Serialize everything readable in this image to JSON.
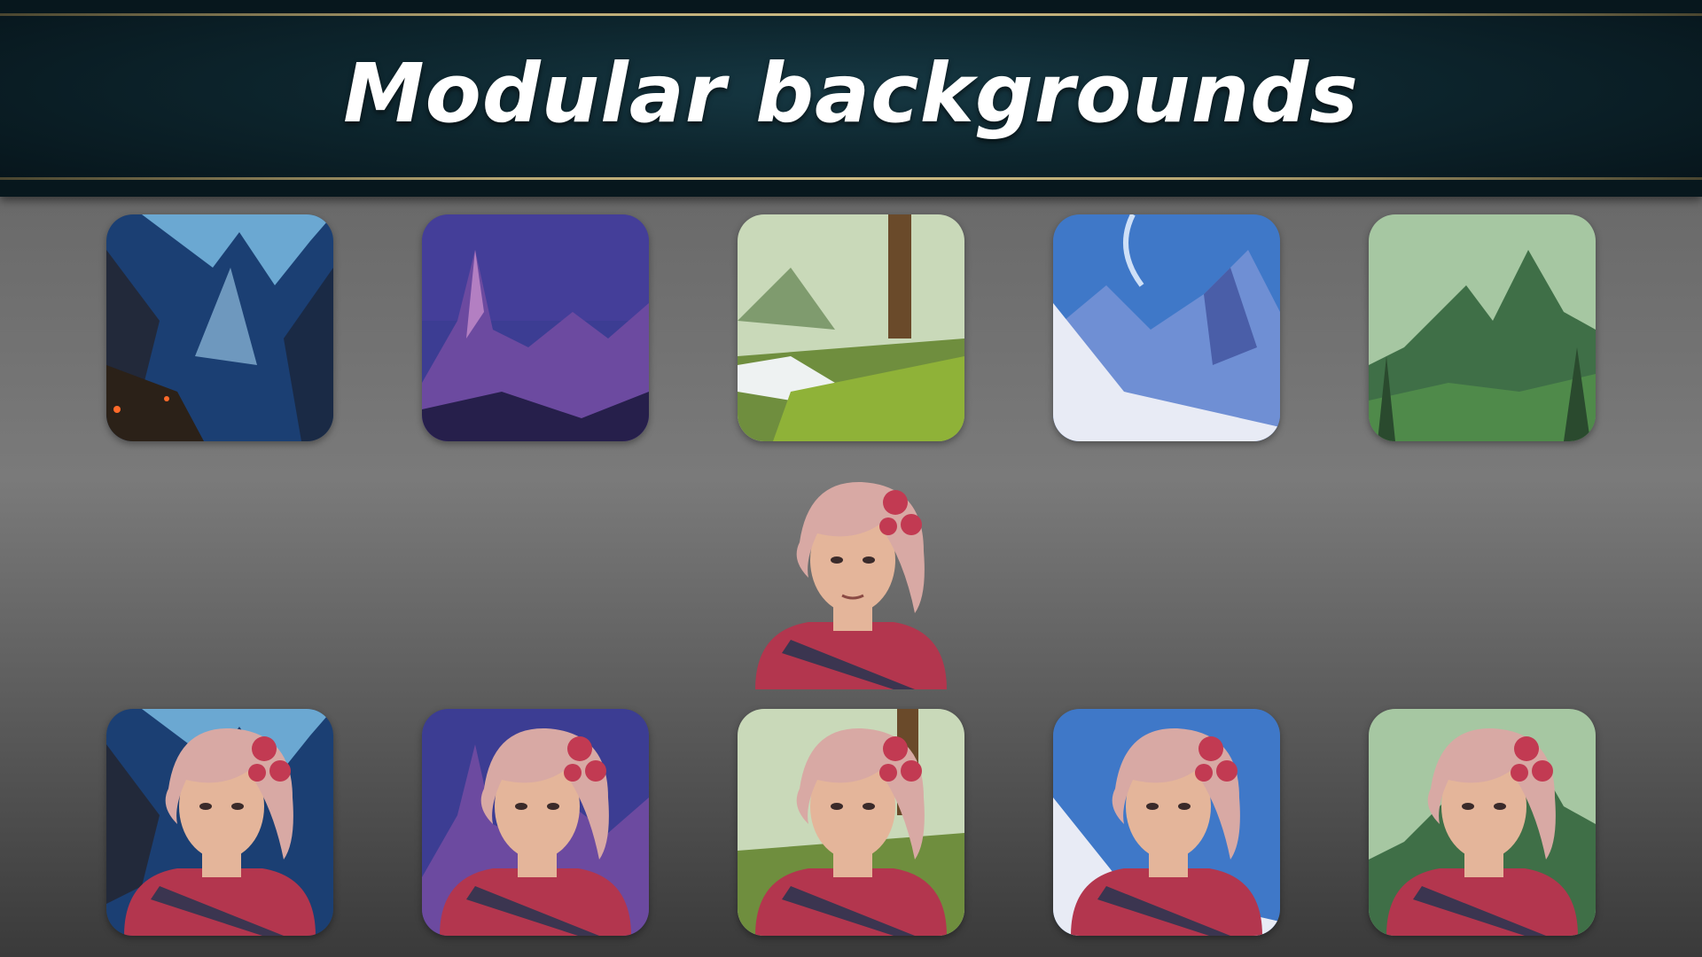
{
  "title": "Modular backgrounds",
  "backgrounds": [
    {
      "name": "crystal-cave",
      "sky": "#1b3f73",
      "accent": "#7fc3ea",
      "ground": "#2b2118"
    },
    {
      "name": "purple-peaks",
      "sky": "#3c3d93",
      "accent": "#9a5aa8",
      "ground": "#261f4b"
    },
    {
      "name": "forest-waterfall",
      "sky": "#c9d9b9",
      "accent": "#6f8e3e",
      "ground": "#8fb238"
    },
    {
      "name": "ice-mountains",
      "sky": "#3f78c8",
      "accent": "#9fb8e6",
      "ground": "#e8ebf5"
    },
    {
      "name": "green-valley",
      "sky": "#a6c7a2",
      "accent": "#3f6f47",
      "ground": "#4f8a4a"
    }
  ],
  "character": {
    "hair": "#d8a9a4",
    "flower": "#c23a52",
    "skin": "#e4b59a",
    "armor": "#b3364e",
    "strap": "#3b3550"
  }
}
